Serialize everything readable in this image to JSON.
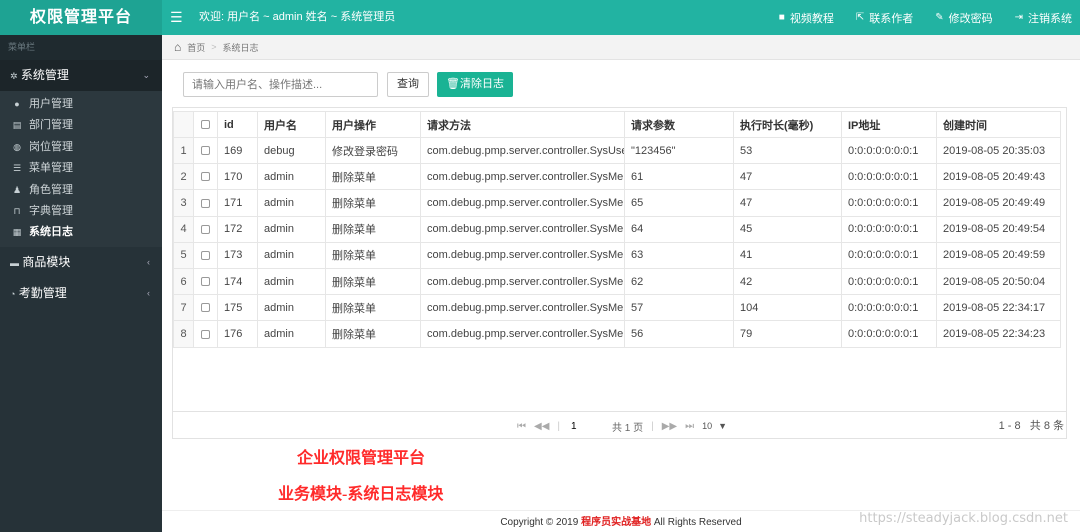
{
  "header": {
    "brand": "权限管理平台",
    "menu_toggle_icon": "hamburger-icon",
    "welcome": "欢迎:  用户名 ~ admin   姓名 ~ 系统管理员",
    "links": [
      {
        "icon": "video-icon",
        "label": "视频教程"
      },
      {
        "icon": "external-link-icon",
        "label": "联系作者"
      },
      {
        "icon": "edit-icon",
        "label": "修改密码"
      },
      {
        "icon": "logout-icon",
        "label": "注销系统"
      }
    ]
  },
  "sidebar": {
    "header": "菜单栏",
    "groups": [
      {
        "label": "系统管理",
        "icon": "gear-icon",
        "expanded": true,
        "items": [
          {
            "label": "用户管理",
            "icon": "user-icon"
          },
          {
            "label": "部门管理",
            "icon": "document-icon"
          },
          {
            "label": "岗位管理",
            "icon": "globe-icon"
          },
          {
            "label": "菜单管理",
            "icon": "list-icon"
          },
          {
            "label": "角色管理",
            "icon": "user-group-icon"
          },
          {
            "label": "字典管理",
            "icon": "bookmark-icon"
          },
          {
            "label": "系统日志",
            "icon": "file-icon",
            "active": true
          }
        ]
      },
      {
        "label": "商品模块",
        "icon": "cart-icon",
        "expanded": false
      },
      {
        "label": "考勤管理",
        "icon": "clock-icon",
        "expanded": false
      }
    ]
  },
  "breadcrumb": {
    "home": "首页",
    "current": "系统日志"
  },
  "toolbar": {
    "search_placeholder": "请输入用户名、操作描述...",
    "query_label": "查询",
    "clear_label": "清除日志"
  },
  "table": {
    "columns": [
      "id",
      "用户名",
      "用户操作",
      "请求方法",
      "请求参数",
      "执行时长(毫秒)",
      "IP地址",
      "创建时间"
    ],
    "rows": [
      {
        "n": "1",
        "id": "169",
        "user": "debug",
        "op": "修改登录密码",
        "method": "com.debug.pmp.server.controller.SysUserController",
        "params": "\"123456\"",
        "duration": "53",
        "ip": "0:0:0:0:0:0:0:1",
        "time": "2019-08-05 20:35:03"
      },
      {
        "n": "2",
        "id": "170",
        "user": "admin",
        "op": "删除菜单",
        "method": "com.debug.pmp.server.controller.SysMenuController",
        "params": "61",
        "duration": "47",
        "ip": "0:0:0:0:0:0:0:1",
        "time": "2019-08-05 20:49:43"
      },
      {
        "n": "3",
        "id": "171",
        "user": "admin",
        "op": "删除菜单",
        "method": "com.debug.pmp.server.controller.SysMenuController",
        "params": "65",
        "duration": "47",
        "ip": "0:0:0:0:0:0:0:1",
        "time": "2019-08-05 20:49:49"
      },
      {
        "n": "4",
        "id": "172",
        "user": "admin",
        "op": "删除菜单",
        "method": "com.debug.pmp.server.controller.SysMenuController",
        "params": "64",
        "duration": "45",
        "ip": "0:0:0:0:0:0:0:1",
        "time": "2019-08-05 20:49:54"
      },
      {
        "n": "5",
        "id": "173",
        "user": "admin",
        "op": "删除菜单",
        "method": "com.debug.pmp.server.controller.SysMenuController",
        "params": "63",
        "duration": "41",
        "ip": "0:0:0:0:0:0:0:1",
        "time": "2019-08-05 20:49:59"
      },
      {
        "n": "6",
        "id": "174",
        "user": "admin",
        "op": "删除菜单",
        "method": "com.debug.pmp.server.controller.SysMenuController",
        "params": "62",
        "duration": "42",
        "ip": "0:0:0:0:0:0:0:1",
        "time": "2019-08-05 20:50:04"
      },
      {
        "n": "7",
        "id": "175",
        "user": "admin",
        "op": "删除菜单",
        "method": "com.debug.pmp.server.controller.SysMenuController",
        "params": "57",
        "duration": "104",
        "ip": "0:0:0:0:0:0:0:1",
        "time": "2019-08-05 22:34:17"
      },
      {
        "n": "8",
        "id": "176",
        "user": "admin",
        "op": "删除菜单",
        "method": "com.debug.pmp.server.controller.SysMenuController",
        "params": "56",
        "duration": "79",
        "ip": "0:0:0:0:0:0:0:1",
        "time": "2019-08-05 22:34:23"
      }
    ]
  },
  "pager": {
    "page_input": "1",
    "total_pages": "共 1 页",
    "page_size": "10",
    "range": "1 - 8",
    "total": "共 8 条"
  },
  "promo": {
    "line1": "企业权限管理平台",
    "line2": "业务模块-系统日志模块"
  },
  "footer": {
    "prefix": "Copyright ©   2019 ",
    "brand": "程序员实战基地",
    "suffix": " All Rights Reserved"
  },
  "watermark": "https://steadyjack.blog.csdn.net",
  "colors": {
    "header": "#22b3a2",
    "sidebar": "#263238",
    "accent_button": "#1ab394",
    "promo_red": "#ff2a2a"
  }
}
